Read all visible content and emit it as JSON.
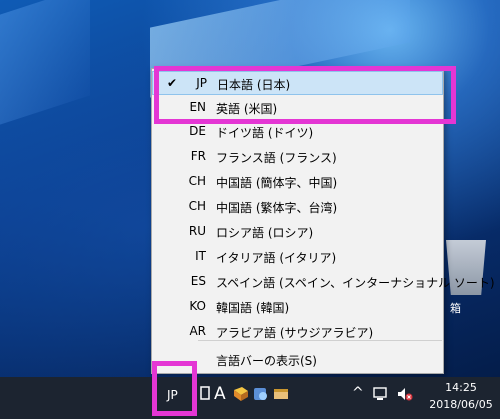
{
  "menu": {
    "items": [
      {
        "code": "JP",
        "label": "日本語 (日本)",
        "checked": true
      },
      {
        "code": "EN",
        "label": "英語 (米国)",
        "checked": false
      },
      {
        "code": "DE",
        "label": "ドイツ語 (ドイツ)",
        "checked": false
      },
      {
        "code": "FR",
        "label": "フランス語 (フランス)",
        "checked": false
      },
      {
        "code": "CH",
        "label": "中国語 (簡体字、中国)",
        "checked": false
      },
      {
        "code": "CH",
        "label": "中国語 (繁体字、台湾)",
        "checked": false
      },
      {
        "code": "RU",
        "label": "ロシア語 (ロシア)",
        "checked": false
      },
      {
        "code": "IT",
        "label": "イタリア語 (イタリア)",
        "checked": false
      },
      {
        "code": "ES",
        "label": "スペイン語 (スペイン、インターナショナル ソート)",
        "checked": false
      },
      {
        "code": "KO",
        "label": "韓国語 (韓国)",
        "checked": false
      },
      {
        "code": "AR",
        "label": "アラビア語 (サウジアラビア)",
        "checked": false
      }
    ],
    "show_bar": "言語バーの表示(S)",
    "check_mark": "✔"
  },
  "desktop": {
    "recycle_label": "箱"
  },
  "taskbar": {
    "lang": "JP",
    "ime": "A",
    "chevron": "^",
    "time": "14:25",
    "date": "2018/06/05"
  },
  "colors": {
    "highlight_box": "#e436d4",
    "menu_bg": "#f2f2f2",
    "hover": "#cce4f7"
  }
}
